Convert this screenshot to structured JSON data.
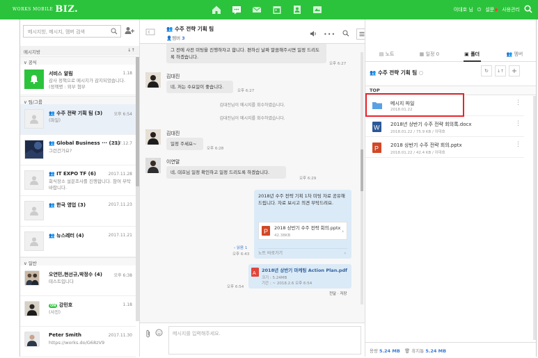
{
  "topbar": {
    "logo_small": "WORKS MOBILE",
    "logo_big": "BIZ.",
    "nav_icons": [
      "home-icon",
      "message-icon",
      "mail-icon",
      "calendar-icon",
      "contacts-icon",
      "drive-icon"
    ],
    "user_name": "이대호 님",
    "settings_label": "설문",
    "admin_label": "사용관리",
    "brand_color": "#2cc33c"
  },
  "sidebar": {
    "search_placeholder": "메시지방, 메시지, 멤버 검색",
    "section_title": "메시지방",
    "sort_label": "↓↑",
    "groups": {
      "official": "공식",
      "team": "팀/그룹",
      "general": "일반"
    },
    "rooms": [
      {
        "name": "서비스 알림",
        "time": "1.18",
        "preview": "감사 정책으로 메시지가 감지되었습니다. (정책명 : 외부 첨부"
      },
      {
        "name": "수주 전략 기획 팀 (3)",
        "time": "오후 6:54",
        "preview": "(파일)"
      },
      {
        "name": "Global Business ··· (21)",
        "time": "2017.12.7",
        "preview": "그런건가요?"
      },
      {
        "name": "IT EXPO TF (6)",
        "time": "2017.11.28",
        "preview": "회식장소 설문조사를 진행합니다. 참여 부탁 바랍니다."
      },
      {
        "name": "한국 영업 (3)",
        "time": "2017.11.23",
        "preview": ""
      },
      {
        "name": "뉴스레터 (4)",
        "time": "2017.11.21",
        "preview": ""
      },
      {
        "name": "오연민,현선규,박정수 (4)",
        "time": "오후 6:38",
        "preview": "테스트입니다"
      },
      {
        "name": "강민호",
        "time": "1.18",
        "preview": "(사진)",
        "badge": "ON"
      },
      {
        "name": "Peter Smith",
        "time": "2017.11.30",
        "preview": "https://works.do/G68zV9"
      }
    ]
  },
  "chat": {
    "title": "수주 전략 기획 팀",
    "members_label": "멤버",
    "members_count": "3",
    "messages": {
      "m1_text": "그 전에 사전 미팅을 진행하자고 합니다. 편하신 날짜 말씀해주시면 일정 드리도록 하겠습니다.",
      "m1_time": "오후 6:27",
      "m2_sender": "김대진",
      "m2_text": "네, 저는 수요일이 좋습니다.",
      "m2_time": "오후 6:27",
      "sys1": "김대진님이 메시지를 회수하였습니다.",
      "sys2": "김대진님이 메시지를 회수하였습니다.",
      "m3_sender": "김대진",
      "m3_text": "일정 주세요~",
      "m3_time": "오후 6:28",
      "m4_sender": "이연말",
      "m4_text": "네, 대호님 일정 확인하고 일정 드리도록 하겠습니다.",
      "m4_time": "오후 6:29",
      "m5_text": "2018년 수주 전략 기획 1차 미팅 자료 공유해 드립니다. 자료 보시고 의견 부탁드려요.",
      "m5_file_name": "2018 상반기 수주 전략 회의.pptx",
      "m5_file_size": "42.38KB",
      "m5_note_link": "노트 바로가기",
      "m5_reply": "읽음 1",
      "m5_time": "오후 6:43",
      "m6_file_title": "2018년 상반기 마케팅 Action Plan.pdf",
      "m6_size_label": "크기 : 5.24MB",
      "m6_expire_label": "기간 : ~ 2018.2.6 오후 6:54",
      "m6_time": "오후 6:54",
      "m6_save": "전달 · 저장"
    },
    "composer_placeholder": "메시지를 입력해주세요."
  },
  "panel": {
    "tabs": [
      "노트",
      "일정 0",
      "폴더",
      "멤버"
    ],
    "title": "수주 전략 기획 팀",
    "top_label": "TOP",
    "files": [
      {
        "name": "메시지 파일",
        "meta": "2018.01.22",
        "type": "folder"
      },
      {
        "name": "2018년 상반기 수주 전략 회의록.docx",
        "meta": "2018.01.22 / 75.9 KB / 이대호",
        "type": "word"
      },
      {
        "name": "2018 상반기 수주 전략 회의.pptx",
        "meta": "2018.01.22 / 42.4 KB / 이대호",
        "type": "ppt"
      }
    ],
    "footer_used_label": "용량",
    "footer_used": "5.24 MB",
    "footer_trash_label": "휴지통",
    "footer_trash": "5.24 MB"
  }
}
